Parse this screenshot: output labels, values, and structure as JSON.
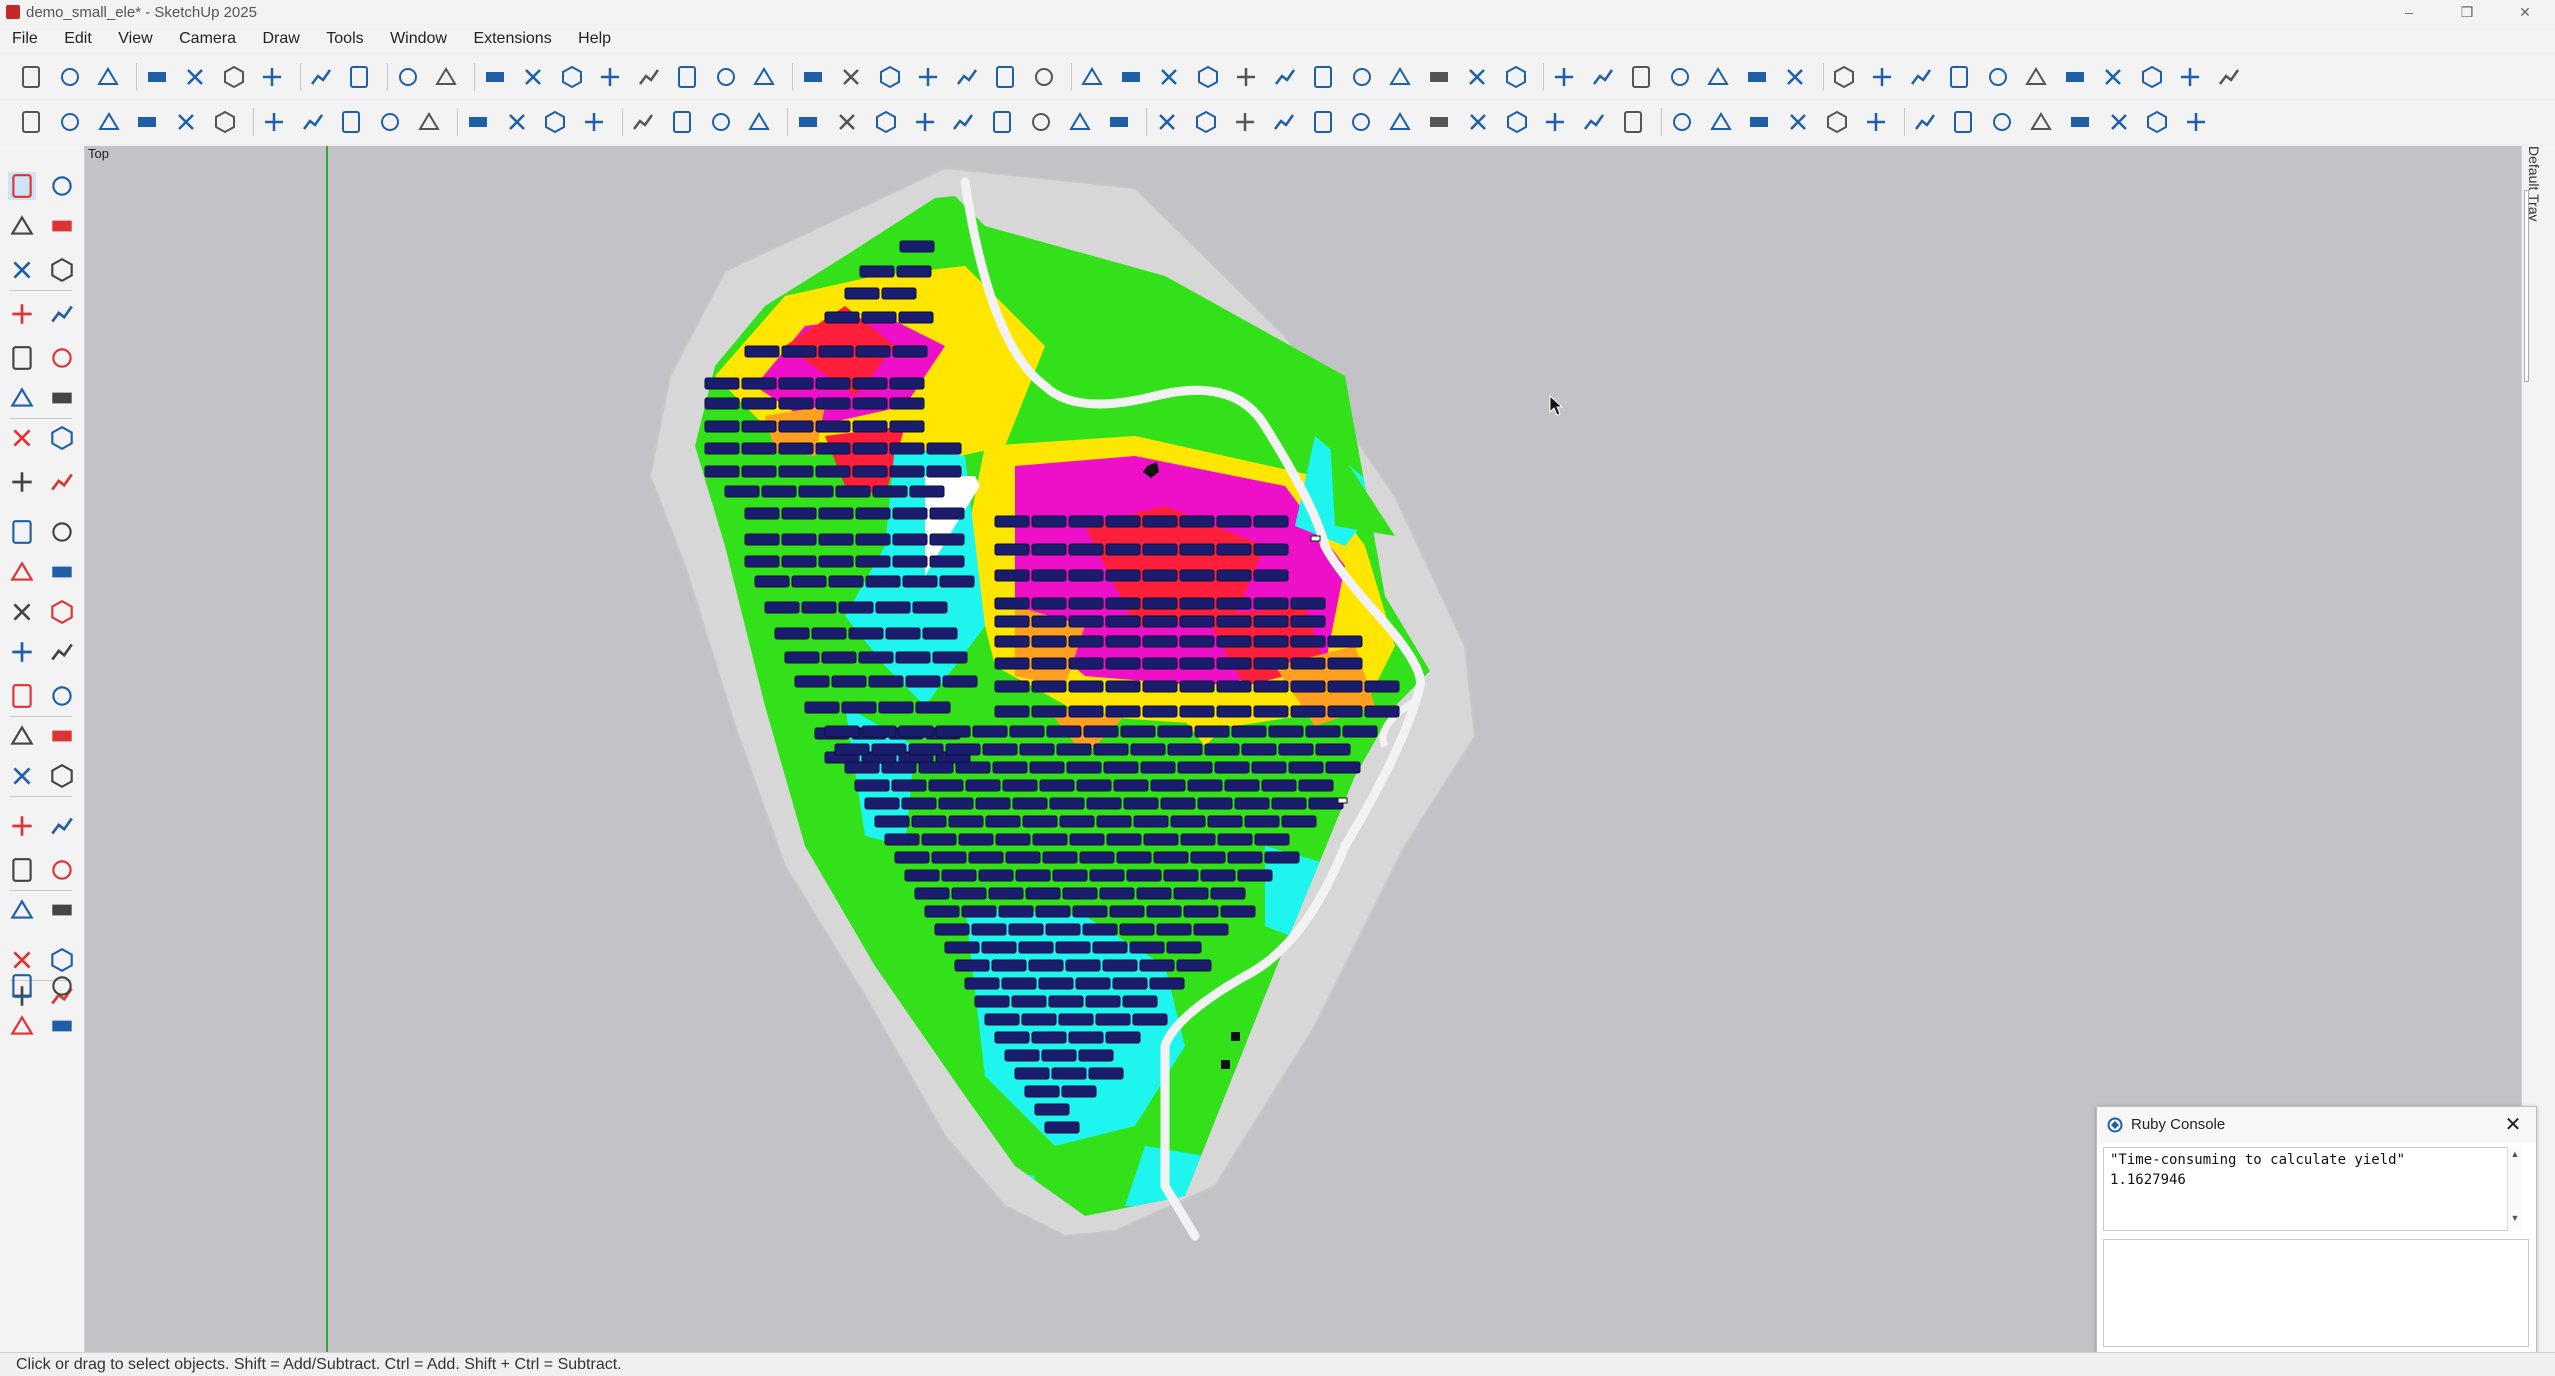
{
  "window": {
    "title": "demo_small_ele* - SketchUp 2025",
    "minimize": "–",
    "maximize": "❐",
    "close": "✕"
  },
  "menu": [
    "File",
    "Edit",
    "View",
    "Camera",
    "Draw",
    "Tools",
    "Window",
    "Extensions",
    "Help"
  ],
  "viewport": {
    "view_label": "Top"
  },
  "tray": {
    "label": "Default Tray"
  },
  "console": {
    "title": "Ruby Console",
    "close": "✕",
    "output_lines": [
      "\"Time-consuming to calculate yield\"",
      "1.1627946"
    ]
  },
  "statusbar": {
    "text": "Click or drag to select objects. Shift = Add/Subtract. Ctrl = Add. Shift + Ctrl = Subtract."
  },
  "colors": {
    "accent_blue": "#1f5fa8",
    "terrain_green": "#33e11a",
    "heat_magenta": "#ee10c8",
    "heat_red": "#ff1f3a",
    "heat_yellow": "#ffe600",
    "heat_orange": "#ffa020",
    "water_cyan": "#1ef5ee",
    "panel_navy": "#1a1d6e",
    "road": "#f2f2f2",
    "viewport_bg": "#c3c3c7"
  },
  "icons": {
    "row1": [
      "new-file-icon",
      "open-folder-icon",
      "save-icon",
      "cut-icon",
      "copy-icon",
      "paste-icon",
      "erase-icon",
      "undo-icon",
      "redo-icon",
      "print-icon",
      "model-info-icon",
      "iso-view-icon",
      "top-view-icon",
      "front-view-icon",
      "right-view-icon",
      "back-view-icon",
      "left-view-icon",
      "bottom-view-icon",
      "xray-icon",
      "backedges-icon",
      "wireframe-icon",
      "hidden-line-icon",
      "shaded-icon",
      "shaded-textures-icon",
      "monochrome-icon",
      "style-icon",
      "house-icon",
      "text-icon",
      "tower-icon",
      "pin-icon",
      "crosshair-icon",
      "pole-icon",
      "cube-icon",
      "fence-icon",
      "panel-icon",
      "scale-icon",
      "hide-icon",
      "filter-icon",
      "search-icon",
      "angle-icon",
      "dimension-icon",
      "measure-icon",
      "align-icon",
      "spacing-icon",
      "lock-icon",
      "slope-icon",
      "structure-icon",
      "building-icon",
      "grid-icon",
      "road-icon",
      "snowflake-icon",
      "split-icon",
      "auto-icon",
      "route-icon",
      "network-icon",
      "layout-icon"
    ],
    "row2": [
      "menu-icon",
      "sun-icon",
      "globe-icon",
      "frame-icon",
      "terrain-icon",
      "mountain-icon",
      "array-icon",
      "tilt-icon",
      "module-grid-icon",
      "module-flat-icon",
      "delete-icon",
      "percent-icon",
      "sparkle-icon",
      "stars-icon",
      "cable-icon",
      "layout-grid-icon",
      "inverter-icon",
      "connect-icon",
      "search-route-icon",
      "curve-icon",
      "zoom-cable-icon",
      "ground-icon",
      "link-icon",
      "string-icon",
      "axis-icon",
      "box-icon",
      "combiner-icon",
      "cloud-icon",
      "ruler-icon",
      "tree-icon",
      "image-icon",
      "flag-icon",
      "cross-icon",
      "table-icon",
      "slider-icon",
      "dropbox-icon",
      "mobile-icon",
      "money-icon",
      "kwh-icon",
      "irr-icon",
      "clipboard-icon",
      "gear-icon",
      "users-icon",
      "language-icon",
      "help-icon",
      "upload-icon",
      "refresh-icon",
      "database-icon",
      "loss-icon",
      "bi-icon",
      "play-icon",
      "fit-icon",
      "crop-icon",
      "picture-icon",
      "export-icon"
    ],
    "left": [
      "select-icon",
      "lasso-icon",
      "paint-bucket-icon",
      "eraser-icon",
      "component-icon",
      "tag-icon",
      "pencil-icon",
      "freehand-icon",
      "rectangle-icon",
      "rotated-rectangle-icon",
      "circle-icon",
      "polygon-icon",
      "arc-icon",
      "two-point-arc-icon",
      "pie-icon",
      "three-point-arc-icon",
      "move-icon",
      "push-pull-icon",
      "rotate-icon",
      "follow-me-icon",
      "scale-tool-icon",
      "offset-icon",
      "axes-icon",
      "protractor-icon",
      "tape-measure-icon",
      "dimension-tool-icon",
      "protractor-angle-icon",
      "text-label-icon",
      "axes-orbit-icon",
      "3d-text-icon",
      "section-icon",
      "hand-icon",
      "zoom-icon",
      "zoom-window-icon",
      "zoom-extents-icon",
      "previous-view-icon",
      "position-camera-icon",
      "walk-icon",
      "look-around-icon",
      "field-of-view-icon",
      "settings-layer-icon",
      "tools-layer-icon",
      "stack-icon",
      "stack-settings-icon"
    ]
  }
}
